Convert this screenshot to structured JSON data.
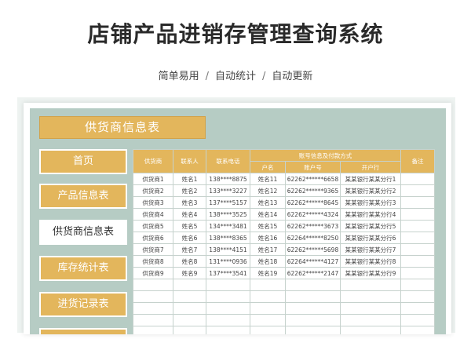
{
  "title": "店铺产品进销存管理查询系统",
  "subtitle": [
    "简单易用",
    "自动统计",
    "自动更新"
  ],
  "subtitle_separator": "/",
  "colors": {
    "accent": "#e3b65c",
    "panel_bg": "#b6ccc4",
    "grid": "#c6d2cd"
  },
  "sheet": {
    "header_banner": "供货商信息表",
    "nav": [
      {
        "label": "首页",
        "active": false
      },
      {
        "label": "产品信息表",
        "active": false
      },
      {
        "label": "供货商信息表",
        "active": true
      },
      {
        "label": "库存统计表",
        "active": false
      },
      {
        "label": "进货记录表",
        "active": false
      },
      {
        "label": "",
        "active": false
      }
    ],
    "table": {
      "headers": {
        "supplier": "供货商",
        "contact": "联系人",
        "phone": "联系电话",
        "account_group": "账号信息及付款方式",
        "account_name": "户名",
        "account_no": "账户号",
        "bank": "开户行",
        "remark": "备注"
      },
      "rows": [
        [
          "供货商1",
          "姓名1",
          "138****8875",
          "姓名11",
          "62262******6658",
          "某某银行某某分行1",
          ""
        ],
        [
          "供货商2",
          "姓名2",
          "133****3227",
          "姓名12",
          "62262******9365",
          "某某银行某某分行2",
          ""
        ],
        [
          "供货商3",
          "姓名3",
          "137****5157",
          "姓名13",
          "62262******8645",
          "某某银行某某分行3",
          ""
        ],
        [
          "供货商4",
          "姓名4",
          "138****3525",
          "姓名14",
          "62262******4324",
          "某某银行某某分行4",
          ""
        ],
        [
          "供货商5",
          "姓名5",
          "134****3481",
          "姓名15",
          "62262******3673",
          "某某银行某某分行5",
          ""
        ],
        [
          "供货商6",
          "姓名6",
          "138****8365",
          "姓名16",
          "62264******8250",
          "某某银行某某分行6",
          ""
        ],
        [
          "供货商7",
          "姓名7",
          "138****4151",
          "姓名17",
          "62262******5698",
          "某某银行某某分行7",
          ""
        ],
        [
          "供货商8",
          "姓名8",
          "131****0936",
          "姓名18",
          "62264******4127",
          "某某银行某某分行8",
          ""
        ],
        [
          "供货商9",
          "姓名9",
          "137****3541",
          "姓名19",
          "62262******2147",
          "某某银行某某分行9",
          ""
        ],
        [
          "",
          "",
          "",
          "",
          "",
          "",
          ""
        ],
        [
          "",
          "",
          "",
          "",
          "",
          "",
          ""
        ],
        [
          "",
          "",
          "",
          "",
          "",
          "",
          ""
        ],
        [
          "",
          "",
          "",
          "",
          "",
          "",
          ""
        ],
        [
          "",
          "",
          "",
          "",
          "",
          "",
          ""
        ],
        [
          "",
          "",
          "",
          "",
          "",
          "",
          ""
        ]
      ]
    }
  }
}
